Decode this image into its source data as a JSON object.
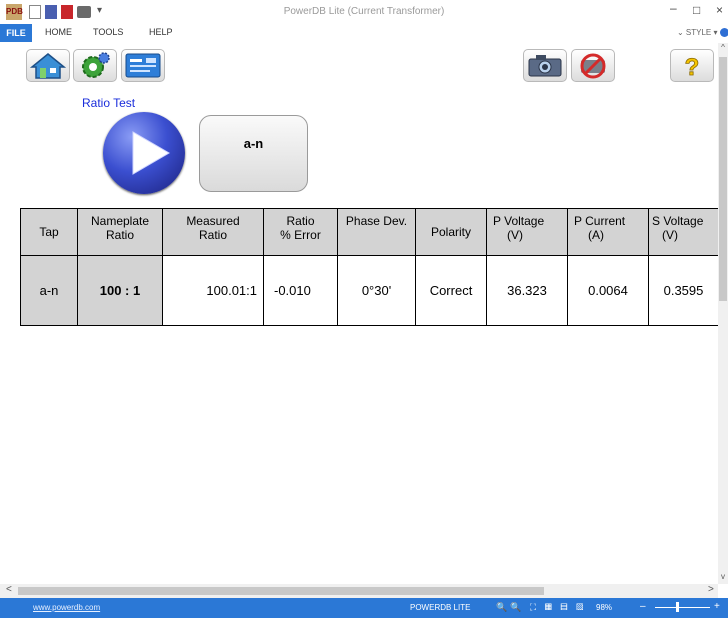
{
  "window": {
    "title": "PowerDB Lite (Current Transformer)",
    "minimize_glyph": "–",
    "maximize_glyph": "□",
    "close_glyph": "×",
    "app_logo_text": "PDB",
    "qa_dropdown_glyph": "▾"
  },
  "menu": {
    "file": "FILE",
    "home": "HOME",
    "tools": "TOOLS",
    "help": "HELP",
    "style": "⌄ STYLE ▾"
  },
  "toolbar": {
    "icons": [
      "home-icon",
      "settings-gear-icon",
      "nameplate-card-icon",
      "camera-icon",
      "no-camera-icon",
      "help-question-icon"
    ],
    "help_glyph": "?"
  },
  "test": {
    "title": "Ratio Test",
    "tap_button_label": "a-n"
  },
  "table": {
    "headers": {
      "tap": "Tap",
      "nameplate_l1": "Nameplate",
      "nameplate_l2": "Ratio",
      "measured_l1": "Measured",
      "measured_l2": "Ratio",
      "ratio_err_l1": "Ratio",
      "ratio_err_l2": "% Error",
      "phase_dev": "Phase Dev.",
      "polarity": "Polarity",
      "p_voltage_l1": "P  Voltage",
      "p_voltage_l2": "(V)",
      "p_current_l1": "P  Current",
      "p_current_l2": "(A)",
      "s_voltage_l1": "S Voltage",
      "s_voltage_l2": "(V)"
    },
    "row": {
      "tap": "a-n",
      "nameplate_ratio": "100 : 1",
      "measured_ratio": "100.01:1",
      "ratio_error": "-0.010",
      "phase_dev": "0°30'",
      "polarity": "Correct",
      "p_voltage": "36.323",
      "p_current": "0.0064",
      "s_voltage": "0.3595"
    }
  },
  "scroll": {
    "up": "^",
    "down": "v",
    "left": "<",
    "right": ">"
  },
  "status": {
    "link": "www.powerdb.com",
    "app_name": "POWERDB LITE",
    "view_icons": "🔍🔍 ⛶ ▦ ▤ ▧",
    "zoom": "98%",
    "zoom_minus": "–",
    "zoom_plus": "+",
    "zoom_level": 0.98
  },
  "colors": {
    "accent": "#2b78d6",
    "title_blue": "#1a2ddb",
    "table_grey": "#d3d3d3"
  }
}
